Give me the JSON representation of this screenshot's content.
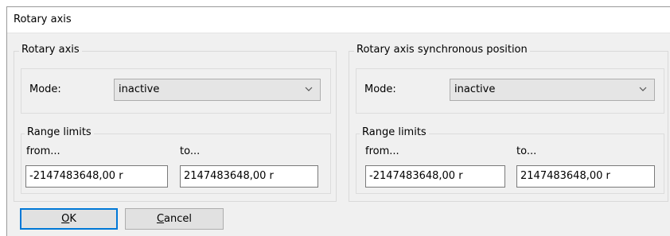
{
  "window": {
    "title": "Rotary axis"
  },
  "left_group": {
    "title": "Rotary axis",
    "mode_label": "Mode:",
    "mode_value": "inactive",
    "range_title": "Range limits",
    "from_label": "from...",
    "to_label": "to...",
    "from_value": "-2147483648,00 r",
    "to_value": "2147483648,00 r"
  },
  "right_group": {
    "title": "Rotary axis synchronous position",
    "mode_label": "Mode:",
    "mode_value": "inactive",
    "range_title": "Range limits",
    "from_label": "from...",
    "to_label": "to...",
    "from_value": "-2147483648,00 r",
    "to_value": "2147483648,00 r"
  },
  "buttons": {
    "ok_mnemonic": "O",
    "ok_rest": "K",
    "cancel_mnemonic": "C",
    "cancel_rest": "ancel"
  },
  "icons": {
    "dropdown": "chevron-down-icon"
  }
}
